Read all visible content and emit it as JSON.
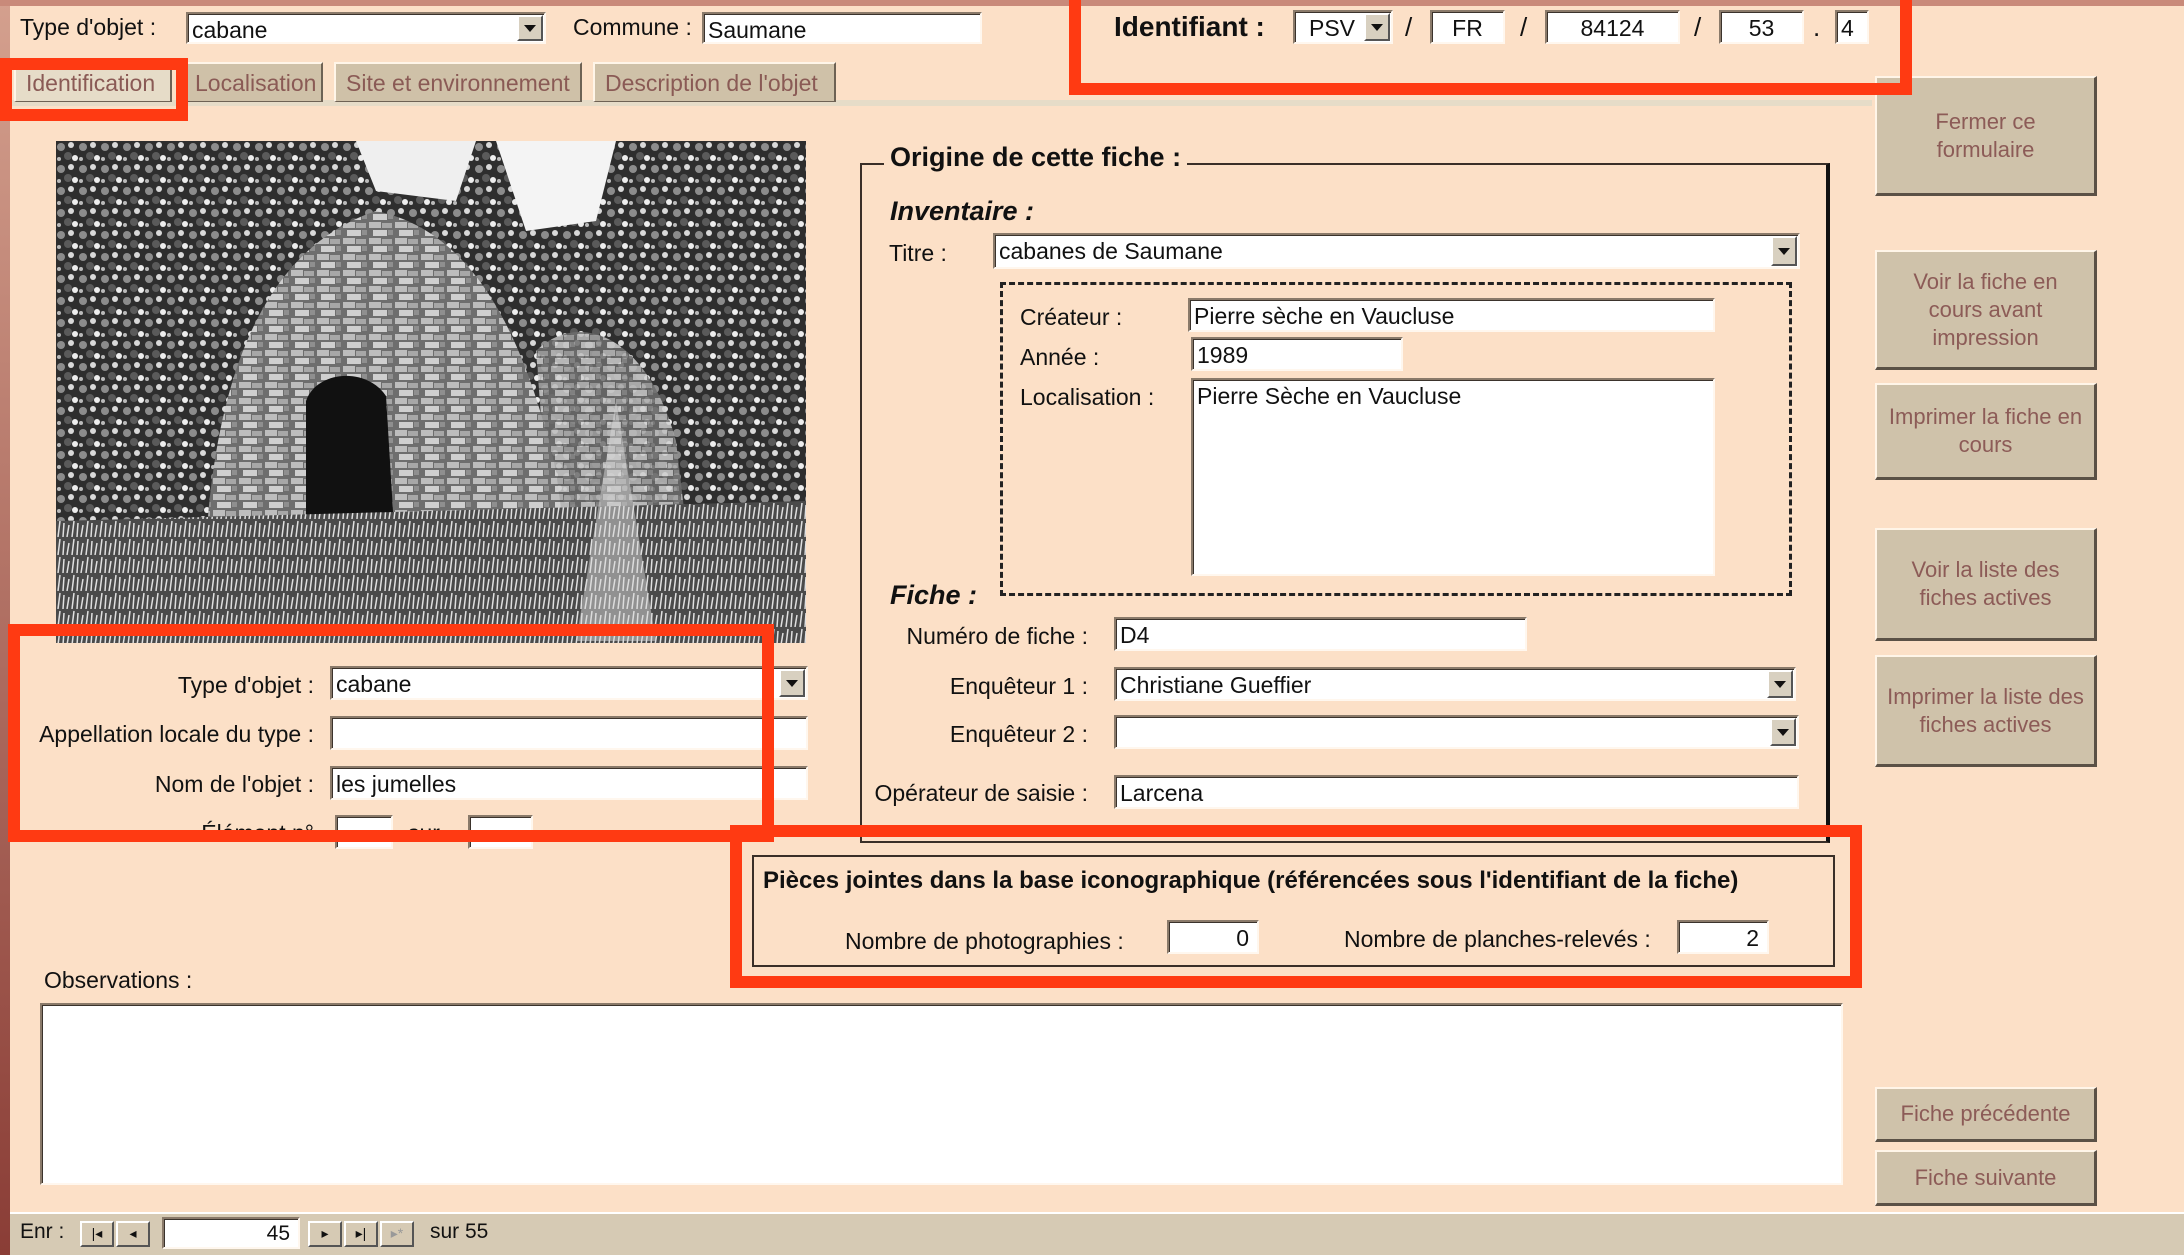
{
  "top": {
    "type_label": "Type d'objet :",
    "type_value": "cabane",
    "commune_label": "Commune :",
    "commune_value": "Saumane",
    "ident_label": "Identifiant :",
    "ident_parts": [
      "PSV",
      "FR",
      "84124",
      "53",
      "4"
    ],
    "ident_sep": "/",
    "ident_dot": "."
  },
  "tabs": [
    {
      "label": "Identification",
      "active": true
    },
    {
      "label": "Localisation",
      "active": false
    },
    {
      "label": "Site et environnement",
      "active": false
    },
    {
      "label": "Description de l'objet",
      "active": false
    }
  ],
  "identification": {
    "type_label": "Type d'objet :",
    "type_value": "cabane",
    "appellation_label": "Appellation locale du type :",
    "appellation_value": "",
    "nom_label": "Nom de l'objet :",
    "nom_value": "les jumelles",
    "element_label": "Élément n°",
    "element_sur": "sur"
  },
  "origine": {
    "title": "Origine de cette fiche :",
    "inventaire_label": "Inventaire :",
    "titre_label": "Titre :",
    "titre_value": "cabanes de Saumane",
    "createur_label": "Créateur :",
    "createur_value": "Pierre sèche en Vaucluse",
    "annee_label": "Année :",
    "annee_value": "1989",
    "localisation_label": "Localisation :",
    "localisation_value": "Pierre Sèche en Vaucluse",
    "fiche_label": "Fiche :",
    "numero_label": "Numéro de fiche :",
    "numero_value": "D4",
    "enqueteur1_label": "Enquêteur 1 :",
    "enqueteur1_value": "Christiane Gueffier",
    "enqueteur2_label": "Enquêteur 2 :",
    "enqueteur2_value": "",
    "operateur_label": "Opérateur de saisie :",
    "operateur_value": "Larcena"
  },
  "pieces": {
    "title": "Pièces jointes dans la base iconographique (référencées sous l'identifiant de la fiche)",
    "photos_label": "Nombre de photographies :",
    "photos_value": "0",
    "planches_label": "Nombre de planches-relevés :",
    "planches_value": "2"
  },
  "observations": {
    "label": "Observations :",
    "value": ""
  },
  "side_buttons": {
    "close": "Fermer ce formulaire",
    "view_current": "Voir la fiche en cours avant impression",
    "print_current": "Imprimer la fiche en cours",
    "view_list": "Voir la liste des fiches actives",
    "print_list": "Imprimer la liste des fiches actives",
    "prev": "Fiche précédente",
    "next": "Fiche suivante"
  },
  "record_nav": {
    "label": "Enr :",
    "current": "45",
    "of_label": "sur 55"
  },
  "colors": {
    "background": "#fce0c7",
    "highlight": "#ff3a12",
    "button_face": "#cfc2aa",
    "button_text": "#8c5b57"
  }
}
